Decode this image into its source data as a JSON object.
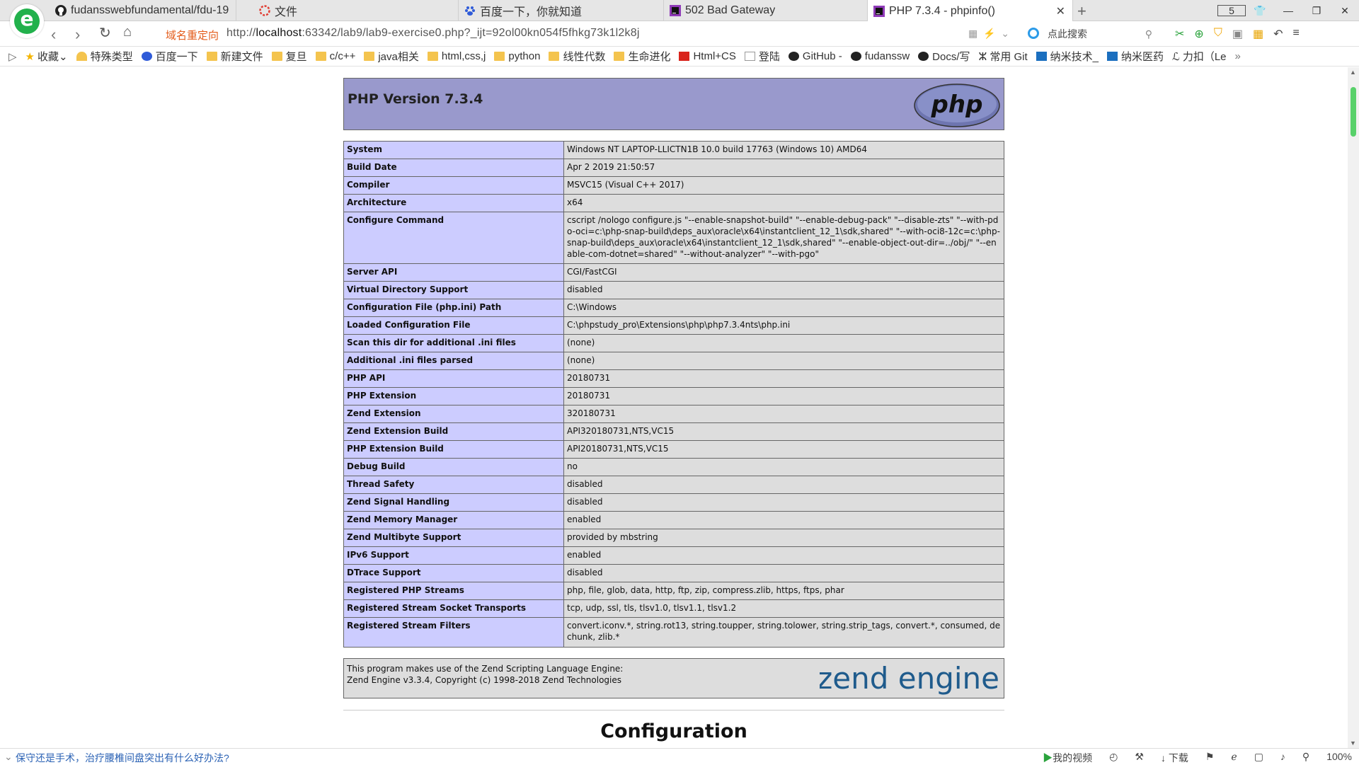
{
  "tabs": [
    {
      "label": "fudansswebfundamental/fdu-19",
      "icon": "github-icon"
    },
    {
      "label": "文件",
      "icon": "file-icon"
    },
    {
      "label": "百度一下，你就知道",
      "icon": "baidu-icon"
    },
    {
      "label": "502 Bad Gateway",
      "icon": "phpstorm-icon"
    },
    {
      "label": "PHP 7.3.4 - phpinfo()",
      "icon": "phpstorm-icon",
      "active": true
    }
  ],
  "tab_count": "5",
  "address": {
    "redirect_label": "域名重定向",
    "url_prefix": "http://",
    "url_host": "localhost",
    "url_rest": ":63342/lab9/lab9-exercise0.php?_ijt=92ol00kn054f5fhkg73k1l2k8j",
    "search_placeholder": "点此搜索"
  },
  "bookmarks": [
    "收藏",
    "特殊类型",
    "百度一下",
    "新建文件",
    "复旦",
    "c/c++",
    "java相关",
    "html,css,j",
    "python",
    "线性代数",
    "生命进化",
    "Html+CS",
    "登陆",
    "GitHub -",
    "fudanssw",
    "Docs/写",
    "常用 Git",
    "纳米技术_",
    "纳米医药",
    "力扣（Le"
  ],
  "php": {
    "title": "PHP Version 7.3.4",
    "logo_text": "php",
    "rows": [
      {
        "key": "System",
        "value": "Windows NT LAPTOP-LLICTN1B 10.0 build 17763 (Windows 10) AMD64"
      },
      {
        "key": "Build Date",
        "value": "Apr 2 2019 21:50:57"
      },
      {
        "key": "Compiler",
        "value": "MSVC15 (Visual C++ 2017)"
      },
      {
        "key": "Architecture",
        "value": "x64"
      },
      {
        "key": "Configure Command",
        "value": "cscript /nologo configure.js \"--enable-snapshot-build\" \"--enable-debug-pack\" \"--disable-zts\" \"--with-pdo-oci=c:\\php-snap-build\\deps_aux\\oracle\\x64\\instantclient_12_1\\sdk,shared\" \"--with-oci8-12c=c:\\php-snap-build\\deps_aux\\oracle\\x64\\instantclient_12_1\\sdk,shared\" \"--enable-object-out-dir=../obj/\" \"--enable-com-dotnet=shared\" \"--without-analyzer\" \"--with-pgo\""
      },
      {
        "key": "Server API",
        "value": "CGI/FastCGI"
      },
      {
        "key": "Virtual Directory Support",
        "value": "disabled"
      },
      {
        "key": "Configuration File (php.ini) Path",
        "value": "C:\\Windows"
      },
      {
        "key": "Loaded Configuration File",
        "value": "C:\\phpstudy_pro\\Extensions\\php\\php7.3.4nts\\php.ini"
      },
      {
        "key": "Scan this dir for additional .ini files",
        "value": "(none)"
      },
      {
        "key": "Additional .ini files parsed",
        "value": "(none)"
      },
      {
        "key": "PHP API",
        "value": "20180731"
      },
      {
        "key": "PHP Extension",
        "value": "20180731"
      },
      {
        "key": "Zend Extension",
        "value": "320180731"
      },
      {
        "key": "Zend Extension Build",
        "value": "API320180731,NTS,VC15"
      },
      {
        "key": "PHP Extension Build",
        "value": "API20180731,NTS,VC15"
      },
      {
        "key": "Debug Build",
        "value": "no"
      },
      {
        "key": "Thread Safety",
        "value": "disabled"
      },
      {
        "key": "Zend Signal Handling",
        "value": "disabled"
      },
      {
        "key": "Zend Memory Manager",
        "value": "enabled"
      },
      {
        "key": "Zend Multibyte Support",
        "value": "provided by mbstring"
      },
      {
        "key": "IPv6 Support",
        "value": "enabled"
      },
      {
        "key": "DTrace Support",
        "value": "disabled"
      },
      {
        "key": "Registered PHP Streams",
        "value": "php, file, glob, data, http, ftp, zip, compress.zlib, https, ftps, phar"
      },
      {
        "key": "Registered Stream Socket Transports",
        "value": "tcp, udp, ssl, tls, tlsv1.0, tlsv1.1, tlsv1.2"
      },
      {
        "key": "Registered Stream Filters",
        "value": "convert.iconv.*, string.rot13, string.toupper, string.tolower, string.strip_tags, convert.*, consumed, dechunk, zlib.*"
      }
    ],
    "zend_line1": "This program makes use of the Zend Scripting Language Engine:",
    "zend_line2": "Zend Engine v3.3.4, Copyright (c) 1998-2018 Zend Technologies",
    "zend_logo_text": "zend engine",
    "config_title": "Configuration"
  },
  "statusbar": {
    "news": "保守还是手术，治疗腰椎间盘突出有什么好办法?",
    "my_video": "我的视频",
    "download": "下载",
    "zoom": "100%"
  },
  "colors": {
    "php_header": "#9999cc",
    "key_cell": "#ccccff",
    "value_cell": "#dddddd",
    "accent_green": "#22b14c"
  }
}
